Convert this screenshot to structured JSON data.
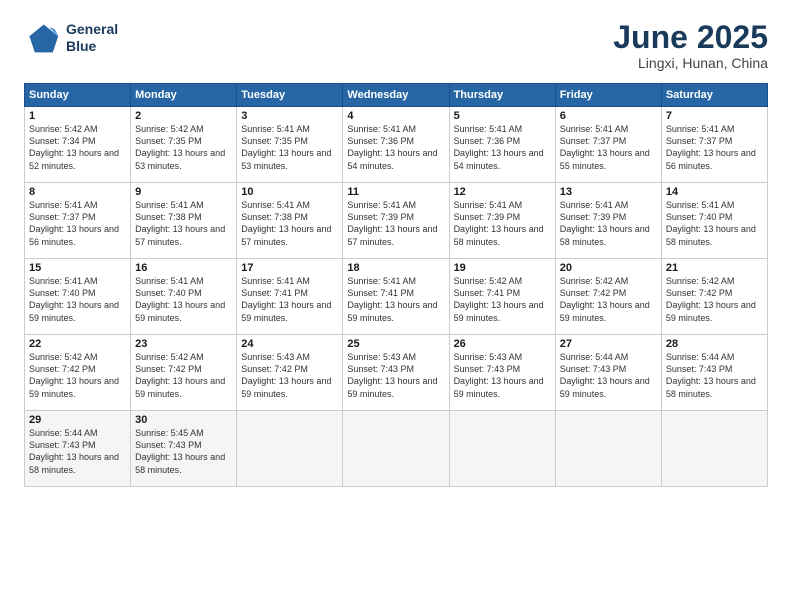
{
  "logo": {
    "line1": "General",
    "line2": "Blue"
  },
  "title": "June 2025",
  "location": "Lingxi, Hunan, China",
  "days_header": [
    "Sunday",
    "Monday",
    "Tuesday",
    "Wednesday",
    "Thursday",
    "Friday",
    "Saturday"
  ],
  "weeks": [
    [
      {
        "day": "1",
        "rise": "5:42 AM",
        "set": "7:34 PM",
        "daylight": "13 hours and 52 minutes."
      },
      {
        "day": "2",
        "rise": "5:42 AM",
        "set": "7:35 PM",
        "daylight": "13 hours and 53 minutes."
      },
      {
        "day": "3",
        "rise": "5:41 AM",
        "set": "7:35 PM",
        "daylight": "13 hours and 53 minutes."
      },
      {
        "day": "4",
        "rise": "5:41 AM",
        "set": "7:36 PM",
        "daylight": "13 hours and 54 minutes."
      },
      {
        "day": "5",
        "rise": "5:41 AM",
        "set": "7:36 PM",
        "daylight": "13 hours and 54 minutes."
      },
      {
        "day": "6",
        "rise": "5:41 AM",
        "set": "7:37 PM",
        "daylight": "13 hours and 55 minutes."
      },
      {
        "day": "7",
        "rise": "5:41 AM",
        "set": "7:37 PM",
        "daylight": "13 hours and 56 minutes."
      }
    ],
    [
      {
        "day": "8",
        "rise": "5:41 AM",
        "set": "7:37 PM",
        "daylight": "13 hours and 56 minutes."
      },
      {
        "day": "9",
        "rise": "5:41 AM",
        "set": "7:38 PM",
        "daylight": "13 hours and 57 minutes."
      },
      {
        "day": "10",
        "rise": "5:41 AM",
        "set": "7:38 PM",
        "daylight": "13 hours and 57 minutes."
      },
      {
        "day": "11",
        "rise": "5:41 AM",
        "set": "7:39 PM",
        "daylight": "13 hours and 57 minutes."
      },
      {
        "day": "12",
        "rise": "5:41 AM",
        "set": "7:39 PM",
        "daylight": "13 hours and 58 minutes."
      },
      {
        "day": "13",
        "rise": "5:41 AM",
        "set": "7:39 PM",
        "daylight": "13 hours and 58 minutes."
      },
      {
        "day": "14",
        "rise": "5:41 AM",
        "set": "7:40 PM",
        "daylight": "13 hours and 58 minutes."
      }
    ],
    [
      {
        "day": "15",
        "rise": "5:41 AM",
        "set": "7:40 PM",
        "daylight": "13 hours and 59 minutes."
      },
      {
        "day": "16",
        "rise": "5:41 AM",
        "set": "7:40 PM",
        "daylight": "13 hours and 59 minutes."
      },
      {
        "day": "17",
        "rise": "5:41 AM",
        "set": "7:41 PM",
        "daylight": "13 hours and 59 minutes."
      },
      {
        "day": "18",
        "rise": "5:41 AM",
        "set": "7:41 PM",
        "daylight": "13 hours and 59 minutes."
      },
      {
        "day": "19",
        "rise": "5:42 AM",
        "set": "7:41 PM",
        "daylight": "13 hours and 59 minutes."
      },
      {
        "day": "20",
        "rise": "5:42 AM",
        "set": "7:42 PM",
        "daylight": "13 hours and 59 minutes."
      },
      {
        "day": "21",
        "rise": "5:42 AM",
        "set": "7:42 PM",
        "daylight": "13 hours and 59 minutes."
      }
    ],
    [
      {
        "day": "22",
        "rise": "5:42 AM",
        "set": "7:42 PM",
        "daylight": "13 hours and 59 minutes."
      },
      {
        "day": "23",
        "rise": "5:42 AM",
        "set": "7:42 PM",
        "daylight": "13 hours and 59 minutes."
      },
      {
        "day": "24",
        "rise": "5:43 AM",
        "set": "7:42 PM",
        "daylight": "13 hours and 59 minutes."
      },
      {
        "day": "25",
        "rise": "5:43 AM",
        "set": "7:43 PM",
        "daylight": "13 hours and 59 minutes."
      },
      {
        "day": "26",
        "rise": "5:43 AM",
        "set": "7:43 PM",
        "daylight": "13 hours and 59 minutes."
      },
      {
        "day": "27",
        "rise": "5:44 AM",
        "set": "7:43 PM",
        "daylight": "13 hours and 59 minutes."
      },
      {
        "day": "28",
        "rise": "5:44 AM",
        "set": "7:43 PM",
        "daylight": "13 hours and 58 minutes."
      }
    ],
    [
      {
        "day": "29",
        "rise": "5:44 AM",
        "set": "7:43 PM",
        "daylight": "13 hours and 58 minutes."
      },
      {
        "day": "30",
        "rise": "5:45 AM",
        "set": "7:43 PM",
        "daylight": "13 hours and 58 minutes."
      },
      null,
      null,
      null,
      null,
      null
    ]
  ]
}
